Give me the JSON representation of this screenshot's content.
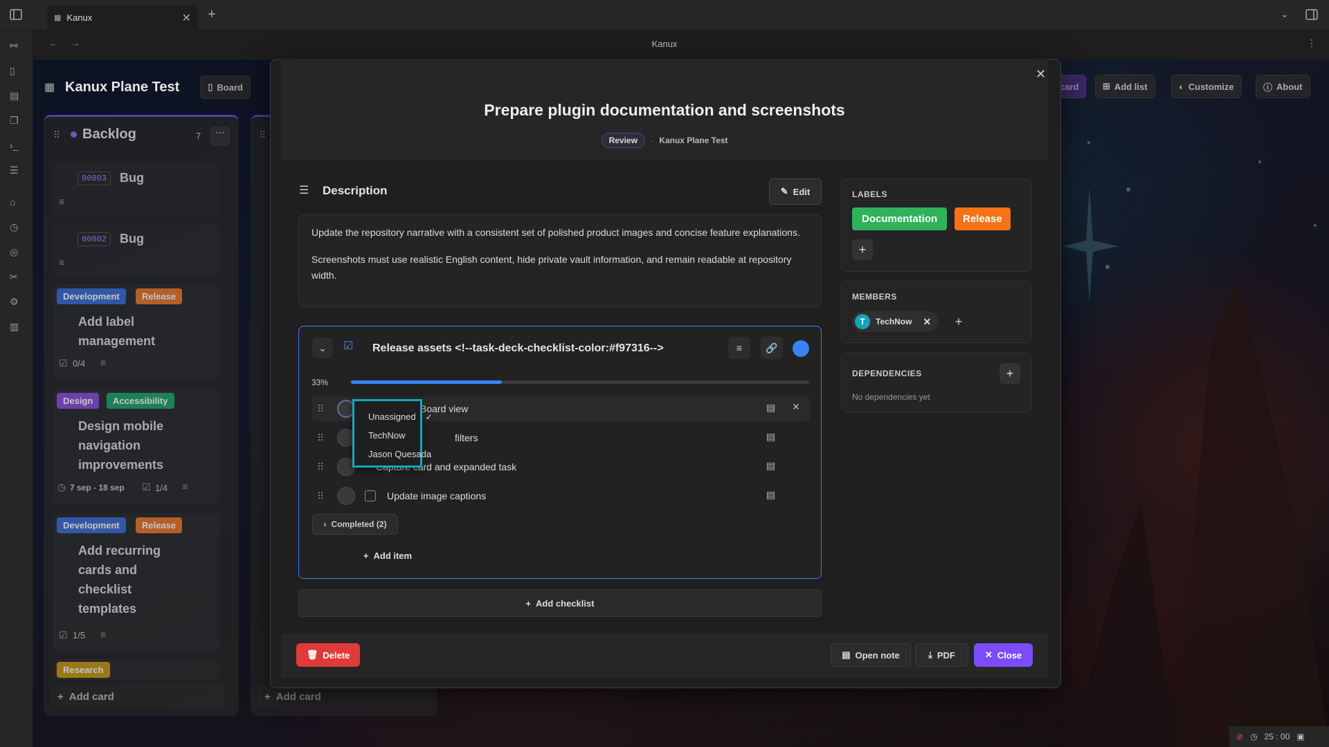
{
  "window": {
    "tab_title": "Kanux",
    "nav_title": "Kanux"
  },
  "board": {
    "title": "Kanux Plane Test",
    "view_button": "Board",
    "add_card_btn": "card",
    "add_list_btn": "Add list",
    "customize_btn": "Customize",
    "about_btn": "About"
  },
  "backlog": {
    "name": "Backlog",
    "count": "7",
    "add_card": "Add card",
    "cards": [
      {
        "id": "00003",
        "title": "Bug"
      },
      {
        "id": "00002",
        "title": "Bug"
      },
      {
        "tags": [
          "Development",
          "Release"
        ],
        "title_l1": "Add label",
        "title_l2": "management",
        "checklist": "0/4"
      },
      {
        "tags": [
          "Design",
          "Accessibility"
        ],
        "title_l1": "Design mobile",
        "title_l2": "navigation",
        "title_l3": "improvements",
        "dates": "7 sep - 18 sep",
        "checklist": "1/4"
      },
      {
        "tags": [
          "Development",
          "Release"
        ],
        "title_l1": "Add recurring",
        "title_l2": "cards and",
        "title_l3": "checklist",
        "title_l4": "templates",
        "checklist": "1/5"
      },
      {
        "tags": [
          "Research"
        ]
      }
    ]
  },
  "second_list": {
    "add_card": "Add card"
  },
  "modal": {
    "title": "Prepare plugin documentation and screenshots",
    "status": "Review",
    "board": "Kanux Plane Test",
    "description": {
      "heading": "Description",
      "edit": "Edit",
      "p1": "Update the repository narrative with a consistent set of polished product images and concise feature explanations.",
      "p2": "Screenshots must use realistic English content, hide private vault information, and remain readable at repository width."
    },
    "checklist": {
      "title": "Release assets <!--task-deck-checklist-color:#f97316-->",
      "progress_text": "33%",
      "progress": 0.33,
      "items": [
        {
          "text": "Board view"
        },
        {
          "text": "filters"
        },
        {
          "text": "Capture card and expanded task"
        },
        {
          "text": "Update image captions"
        }
      ],
      "completed": "Completed (2)",
      "add_item": "Add item"
    },
    "assignee_dropdown": {
      "options": [
        "Unassigned",
        "TechNow",
        "Jason Quesada"
      ],
      "selected": "Unassigned"
    },
    "add_checklist": "Add checklist",
    "labels": {
      "heading": "LABELS",
      "items": [
        "Documentation",
        "Release"
      ]
    },
    "members": {
      "heading": "MEMBERS",
      "initial": "T",
      "name": "TechNow"
    },
    "dependencies": {
      "heading": "DEPENDENCIES",
      "empty": "No dependencies yet"
    },
    "footer": {
      "delete": "Delete",
      "open_note": "Open note",
      "pdf": "PDF",
      "close": "Close"
    }
  },
  "statusbar": {
    "timer": "25 : 00"
  },
  "colors": {
    "accent": "#7c5cff",
    "checklist_accent": "#3b82f6",
    "delete": "#e03b3b",
    "close": "#7c4dff",
    "documentation": "#2fb35a",
    "release": "#f97316"
  }
}
